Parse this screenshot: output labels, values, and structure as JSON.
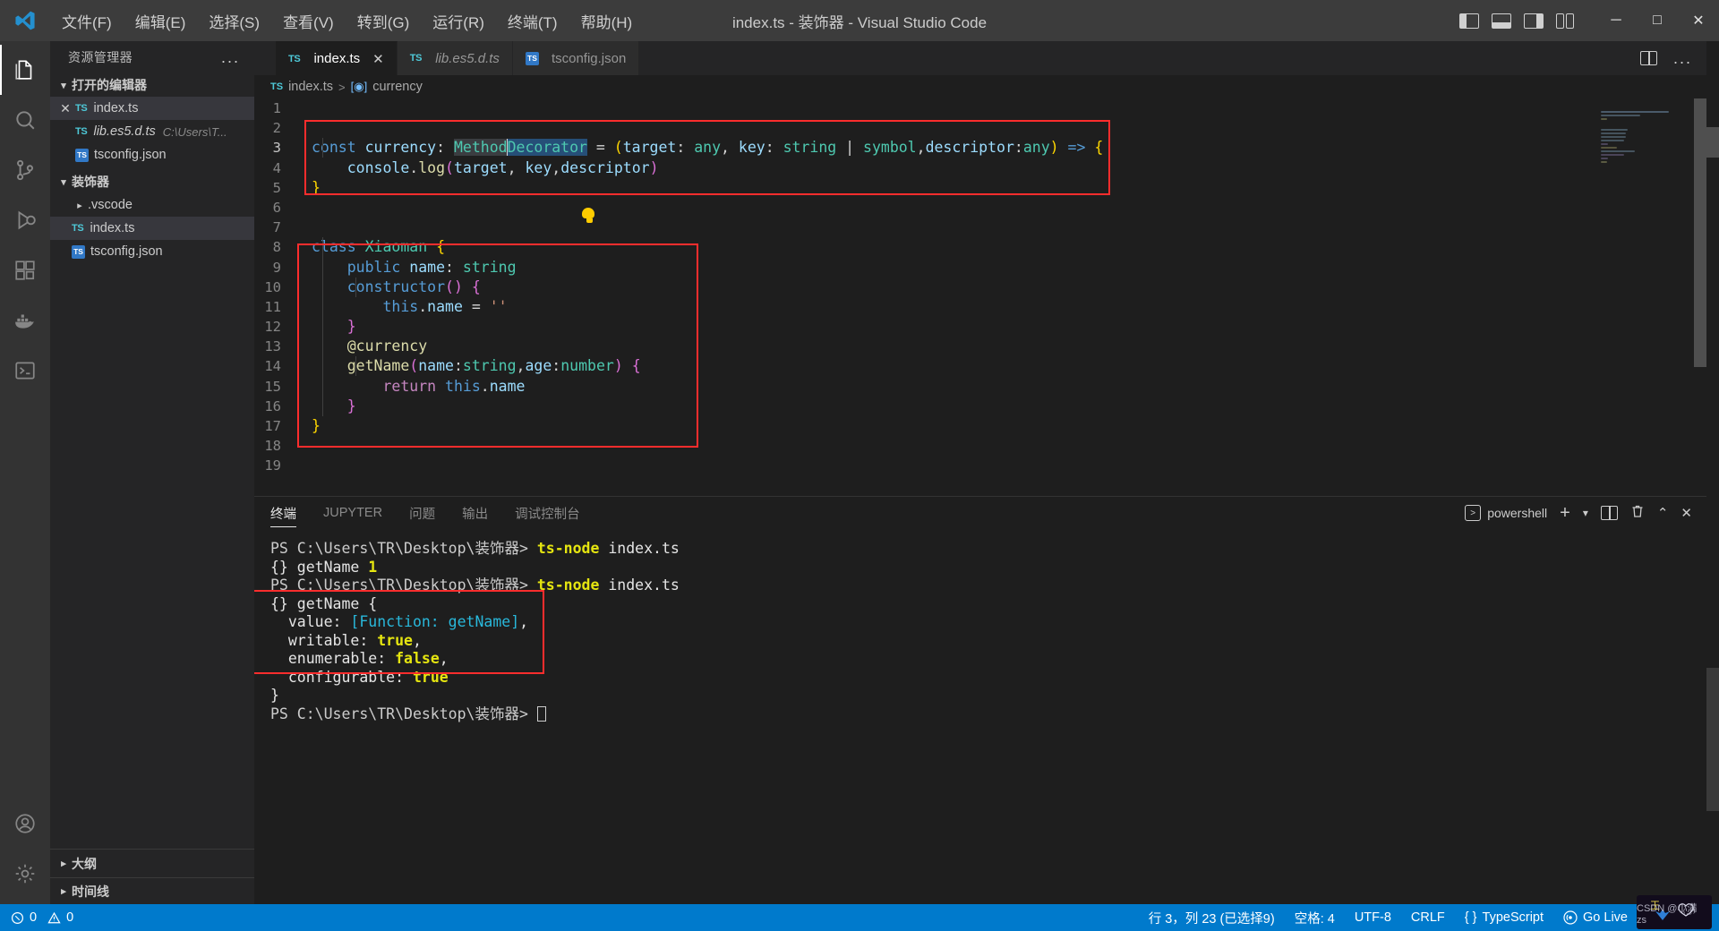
{
  "titlebar": {
    "logo": "vscode-logo",
    "menus": [
      "文件(F)",
      "编辑(E)",
      "选择(S)",
      "查看(V)",
      "转到(G)",
      "运行(R)",
      "终端(T)",
      "帮助(H)"
    ],
    "title": "index.ts - 装饰器 - Visual Studio Code",
    "layout_icons": [
      "toggle-primary-sidebar",
      "toggle-panel",
      "toggle-secondary-sidebar",
      "customize-layout"
    ],
    "window_buttons": {
      "minimize": "─",
      "maximize": "□",
      "close": "✕"
    }
  },
  "activitybar": {
    "items": [
      {
        "name": "explorer",
        "icon": "files-icon",
        "active": true
      },
      {
        "name": "search",
        "icon": "search-icon",
        "active": false
      },
      {
        "name": "source-control",
        "icon": "source-control-icon",
        "active": false
      },
      {
        "name": "run-and-debug",
        "icon": "debug-icon",
        "active": false
      },
      {
        "name": "extensions",
        "icon": "extensions-icon",
        "active": false
      },
      {
        "name": "docker",
        "icon": "docker-icon",
        "active": false
      },
      {
        "name": "remote-terminal",
        "icon": "terminal-icon",
        "active": false
      }
    ],
    "bottom": [
      {
        "name": "accounts",
        "icon": "account-icon"
      },
      {
        "name": "settings",
        "icon": "gear-icon"
      }
    ]
  },
  "sidebar": {
    "title": "资源管理器",
    "more_label": "...",
    "open_editors": {
      "label": "打开的编辑器",
      "items": [
        {
          "name": "index.ts",
          "icon": "ts-icon",
          "detail": "",
          "close": "✕",
          "selected": true,
          "italic": false
        },
        {
          "name": "lib.es5.d.ts",
          "icon": "ts-icon",
          "detail": "C:\\Users\\T...",
          "close": "",
          "selected": false,
          "italic": true
        },
        {
          "name": "tsconfig.json",
          "icon": "tsjson-icon",
          "detail": "",
          "close": "",
          "selected": false,
          "italic": false
        }
      ]
    },
    "workspace": {
      "label": "装饰器",
      "items": [
        {
          "name": ".vscode",
          "icon": "folder-chevron",
          "selected": false
        },
        {
          "name": "index.ts",
          "icon": "ts-icon",
          "selected": true
        },
        {
          "name": "tsconfig.json",
          "icon": "tsjson-icon",
          "selected": false
        }
      ]
    },
    "bottom_sections": [
      {
        "label": "大纲"
      },
      {
        "label": "时间线"
      }
    ]
  },
  "editor": {
    "tabs": [
      {
        "label": "index.ts",
        "icon": "ts-icon",
        "active": true,
        "dirty": false,
        "close": "✕",
        "italic": false
      },
      {
        "label": "lib.es5.d.ts",
        "icon": "ts-icon",
        "active": false,
        "dirty": false,
        "close": "",
        "italic": true
      },
      {
        "label": "tsconfig.json",
        "icon": "tsjson-icon",
        "active": false,
        "dirty": false,
        "close": "",
        "italic": false
      }
    ],
    "actions": {
      "split_editor": "split-editor-icon",
      "more": "..."
    },
    "breadcrumb": {
      "file": "index.ts",
      "separator": ">",
      "symbol": "currency",
      "symbol_icon": "symbol-variable-icon"
    },
    "code_lines": [
      {
        "n": "1",
        "text": ""
      },
      {
        "n": "2",
        "text": ""
      },
      {
        "n": "3",
        "text": "const currency: MethodDecorator = (target: any, key: string | symbol,descriptor:any) => {"
      },
      {
        "n": "4",
        "text": "    console.log(target, key,descriptor)"
      },
      {
        "n": "5",
        "text": "}"
      },
      {
        "n": "6",
        "text": ""
      },
      {
        "n": "7",
        "text": ""
      },
      {
        "n": "8",
        "text": "class Xiaoman {"
      },
      {
        "n": "9",
        "text": "    public name: string"
      },
      {
        "n": "10",
        "text": "    constructor() {"
      },
      {
        "n": "11",
        "text": "        this.name = ''"
      },
      {
        "n": "12",
        "text": "    }"
      },
      {
        "n": "13",
        "text": "    @currency"
      },
      {
        "n": "14",
        "text": "    getName(name:string,age:number) {"
      },
      {
        "n": "15",
        "text": "        return this.name"
      },
      {
        "n": "16",
        "text": "    }"
      },
      {
        "n": "17",
        "text": "}"
      },
      {
        "n": "18",
        "text": ""
      },
      {
        "n": "19",
        "text": ""
      }
    ],
    "selection_text": "MethodDecorator",
    "lightbulb": "quick-fix-lightbulb-icon"
  },
  "panel": {
    "tabs": [
      "终端",
      "JUPYTER",
      "问题",
      "输出",
      "调试控制台"
    ],
    "active_tab": "终端",
    "shell": "powershell",
    "actions": {
      "new_terminal": "+",
      "dropdown": "⌄",
      "split": "split-terminal-icon",
      "kill": "trash-icon",
      "maximize": "⌃",
      "close": "✕"
    },
    "terminal_lines": [
      "PS C:\\Users\\TR\\Desktop\\装饰器> ts-node index.ts",
      "{} getName 1",
      "PS C:\\Users\\TR\\Desktop\\装饰器> ts-node index.ts",
      "{} getName {",
      "  value: [Function: getName],",
      "  writable: true,",
      "  enumerable: false,",
      "  configurable: true",
      "}",
      "PS C:\\Users\\TR\\Desktop\\装饰器> "
    ],
    "prompt": "PS C:\\Users\\TR\\Desktop\\装饰器>",
    "command": "ts-node index.ts"
  },
  "statusbar": {
    "errors": "0",
    "warnings": "0",
    "cursor": "行 3，列 23 (已选择9)",
    "indent": "空格: 4",
    "encoding": "UTF-8",
    "eol": "CRLF",
    "language": "TypeScript",
    "golive": "Go Live",
    "watermark": "CSDN @小满zs"
  },
  "colors": {
    "accent": "#007acc",
    "titlebar_bg": "#3c3c3c",
    "sidebar_bg": "#252526",
    "editor_bg": "#1e1e1e",
    "activitybar_bg": "#333333",
    "annotation_red": "#ff2d2d",
    "selection": "#264f78"
  }
}
